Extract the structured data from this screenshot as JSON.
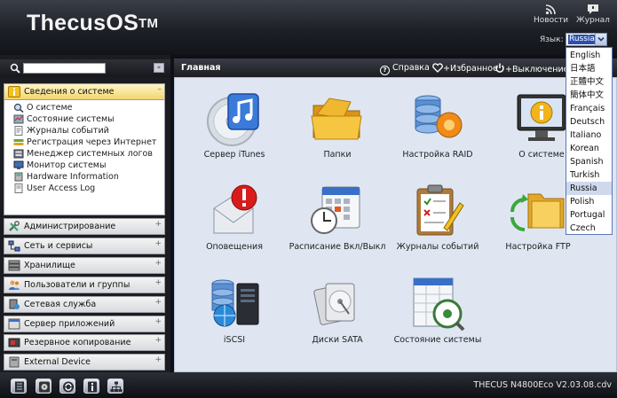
{
  "app": {
    "logo": "ThecusOS",
    "logo_tm": "TM"
  },
  "header": {
    "news_label": "Новости",
    "journal_label": "Журнал",
    "language_label": "Язык:",
    "language_value": "Russia"
  },
  "language_options": [
    "English",
    "日本語",
    "正體中文",
    "簡体中文",
    "Français",
    "Deutsch",
    "Italiano",
    "Korean",
    "Spanish",
    "Turkish",
    "Russia",
    "Polish",
    "Portugal",
    "Czech"
  ],
  "sidebar": {
    "search_placeholder": "",
    "collapse_symbol": "«",
    "open_section": "Сведения о системе",
    "sub_items": [
      "О системе",
      "Состояние системы",
      "Журналы событий",
      "Регистрация через Интернет",
      "Менеджер системных логов",
      "Монитор системы",
      "Hardware Information",
      "User Access Log"
    ],
    "sections": [
      "Администрирование",
      "Сеть и сервисы",
      "Хранилище",
      "Пользователи и группы",
      "Сетевая служба",
      "Сервер приложений",
      "Резервное копирование",
      "External Device"
    ]
  },
  "main": {
    "title": "Главная",
    "help_label": "Справка",
    "favorites_label": "+Избранное",
    "shutdown_label": "+Выключение",
    "tiles": [
      "Сервер iTunes",
      "Папки",
      "Настройка RAID",
      "О системе",
      "Оповещения",
      "Расписание Вкл/Выкл",
      "Журналы событий",
      "Настройка FTP",
      "iSCSI",
      "Диски SATA",
      "Состояние системы"
    ]
  },
  "footer": {
    "version": "THECUS N4800Eco V2.03.08.cdv"
  }
}
